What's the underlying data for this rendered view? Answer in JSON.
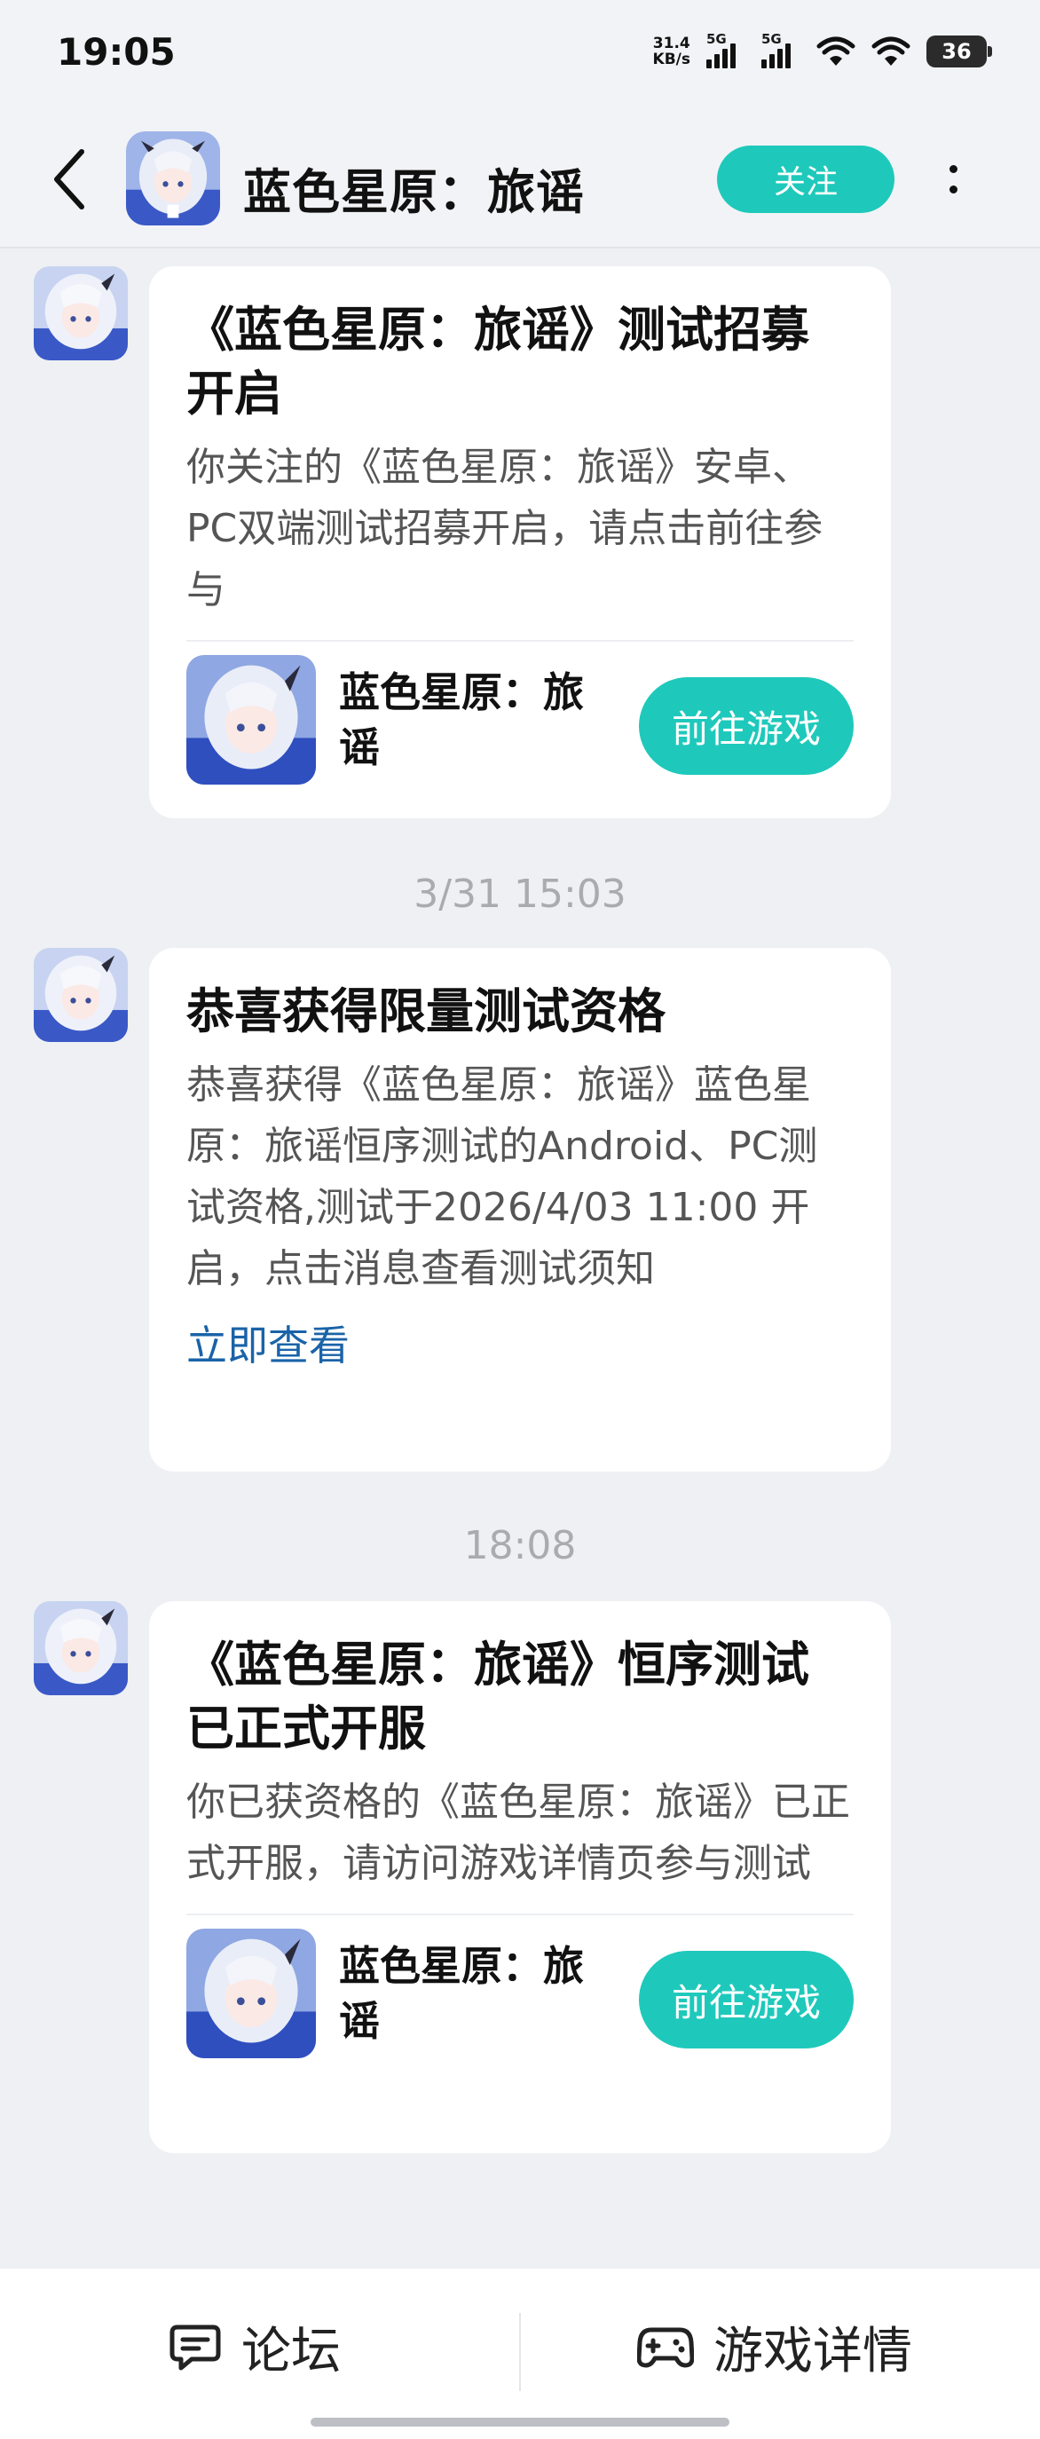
{
  "status_bar": {
    "time": "19:05",
    "net_speed": "31.4\nKB/s",
    "signal1_label": "5G",
    "signal2_label": "5G",
    "battery": "36"
  },
  "header": {
    "title": "蓝色星原：旅谣",
    "follow_label": "关注",
    "back_icon": "chevron-left-icon",
    "more_icon": "more-vertical-icon"
  },
  "messages": [
    {
      "title": "《蓝色星原：旅谣》测试招募开启",
      "body": "你关注的《蓝色星原：旅谣》安卓、PC双端测试招募开启，请点击前往参与",
      "game_name": "蓝色星原：旅谣",
      "button": "前往游戏"
    },
    {
      "timestamp": "3/31  15:03",
      "title": "恭喜获得限量测试资格",
      "body": "恭喜获得《蓝色星原：旅谣》蓝色星原：旅谣恒序测试的Android、PC测试资格,测试于2026/4/03 11:00 开启，点击消息查看测试须知",
      "link": "立即查看"
    },
    {
      "timestamp": "18:08",
      "title": "《蓝色星原：旅谣》恒序测试已正式开服",
      "body": "你已获资格的《蓝色星原：旅谣》已正式开服，请访问游戏详情页参与测试",
      "game_name": "蓝色星原：旅谣",
      "button": "前往游戏"
    }
  ],
  "bottom_bar": {
    "forum_label": "论坛",
    "details_label": "游戏详情"
  },
  "colors": {
    "accent": "#1ec9bb",
    "link": "#1a63a8",
    "background": "#eef0f3"
  }
}
